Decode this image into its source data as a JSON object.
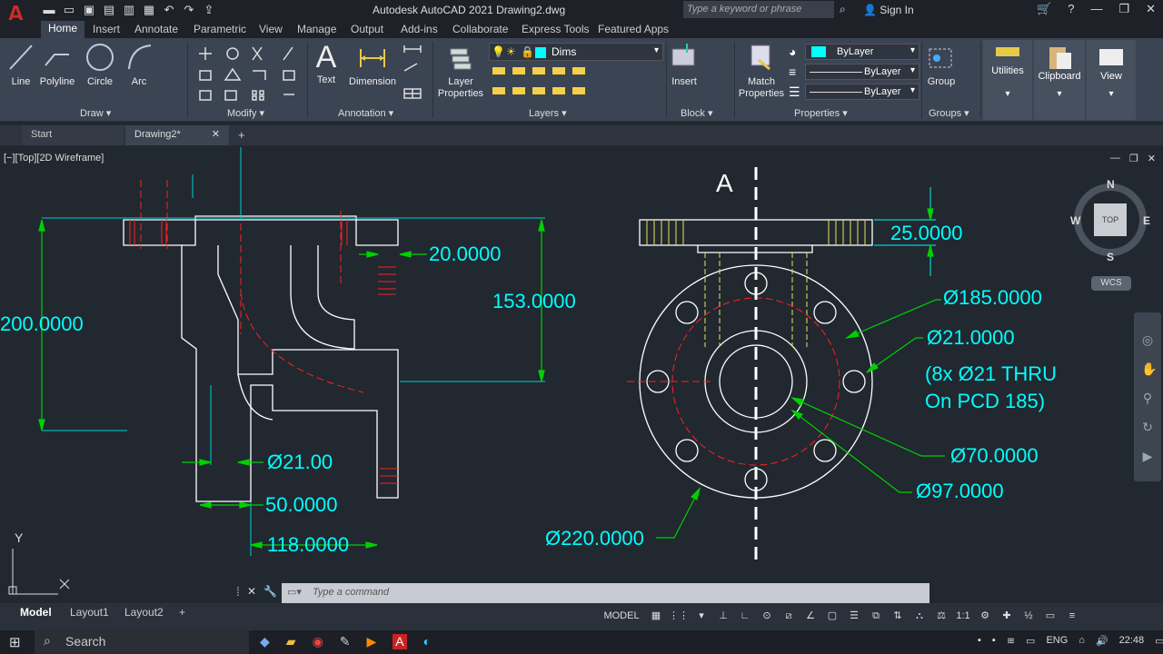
{
  "app": {
    "logo": "A",
    "title": "Autodesk AutoCAD 2021    Drawing2.dwg"
  },
  "search": {
    "placeholder": "Type a keyword or phrase"
  },
  "signin": "Sign In",
  "ribbon_tabs": [
    "Home",
    "Insert",
    "Annotate",
    "Parametric",
    "View",
    "Manage",
    "Output",
    "Add-ins",
    "Collaborate",
    "Express Tools",
    "Featured Apps"
  ],
  "draw": {
    "line": "Line",
    "polyline": "Polyline",
    "circle": "Circle",
    "arc": "Arc",
    "panel": "Draw"
  },
  "modify": {
    "panel": "Modify"
  },
  "annotation": {
    "text": "Text",
    "dimension": "Dimension",
    "panel": "Annotation"
  },
  "layers": {
    "layer_properties": "Layer\nProperties",
    "current_layer": "Dims",
    "panel": "Layers"
  },
  "block": {
    "insert": "Insert",
    "panel": "Block"
  },
  "properties": {
    "match": "Match\nProperties",
    "color": "ByLayer",
    "linetype": "ByLayer",
    "lineweight": "ByLayer",
    "panel": "Properties"
  },
  "groups": {
    "group": "Group",
    "panel": "Groups"
  },
  "utilities": "Utilities",
  "clipboard": "Clipboard",
  "view": "View",
  "doc_tabs": {
    "start": "Start",
    "drawing": "Drawing2*"
  },
  "viewport": {
    "label": "[−][Top][2D Wireframe]"
  },
  "viewcube": {
    "n": "N",
    "s": "S",
    "e": "E",
    "w": "W",
    "top": "TOP",
    "wcs": "WCS"
  },
  "dims": {
    "d200": "200.0000",
    "d20": "20.0000",
    "d153": "153.0000",
    "d21": "Ø21.00",
    "d50": "50.0000",
    "d118": "118.0000",
    "sectionA": "A",
    "d25": "25.0000",
    "d185": "Ø185.0000",
    "d21b": "Ø21.0000",
    "note1": "(8x Ø21 THRU",
    "note2": "On PCD 185)",
    "d70": "Ø70.0000",
    "d97": "Ø97.0000",
    "d220": "Ø220.0000"
  },
  "ucs": {
    "x": "X",
    "y": "Y"
  },
  "command": {
    "placeholder": "Type a command"
  },
  "layout_tabs": [
    "Model",
    "Layout1",
    "Layout2"
  ],
  "status": {
    "model": "MODEL",
    "scale": "1:1"
  },
  "taskbar": {
    "search": "Search",
    "lang": "ENG",
    "time": "22:48"
  },
  "colors": {
    "cyan": "#00ffff",
    "green": "#00d000",
    "red": "#ff2020",
    "yellow": "#e8e35a",
    "bg": "#212830"
  }
}
